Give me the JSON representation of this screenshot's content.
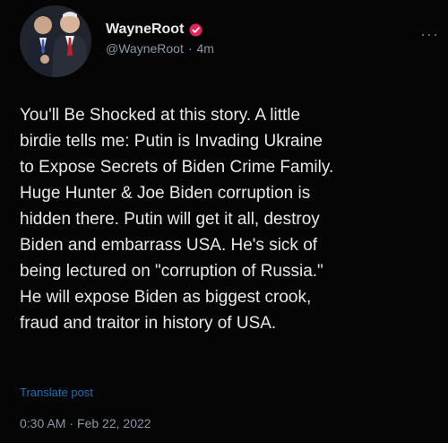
{
  "post": {
    "author": {
      "display_name": "WayneRoot",
      "handle": "@WayneRoot",
      "time_ago": "4m",
      "verified_icon": "verified-badge-icon",
      "badge_color": "#e0245e"
    },
    "more_icon": "more-options-icon",
    "text": "You'll Be Shocked at this story. A little\nbirdie tells me: Putin is Invading Ukraine\nto Expose Secrets of Biden Crime Family.\nHuge Hunter & Joe Biden corruption is\nhidden there. Putin will get it all, destroy\nBiden and embarrass USA. He's sick of\nbeing lectured on \"corruption of Russia.\"\nHe will expose Biden as biggest crook,\nfraud and traitor in history of USA.",
    "translate_label": "Translate post",
    "time": "0:30 AM",
    "date": "Feb 22, 2022",
    "separator": "·"
  },
  "colors": {
    "background": "#050505",
    "text": "#e7e9ea",
    "muted": "#8b98a5",
    "link": "#1d6fb8"
  }
}
